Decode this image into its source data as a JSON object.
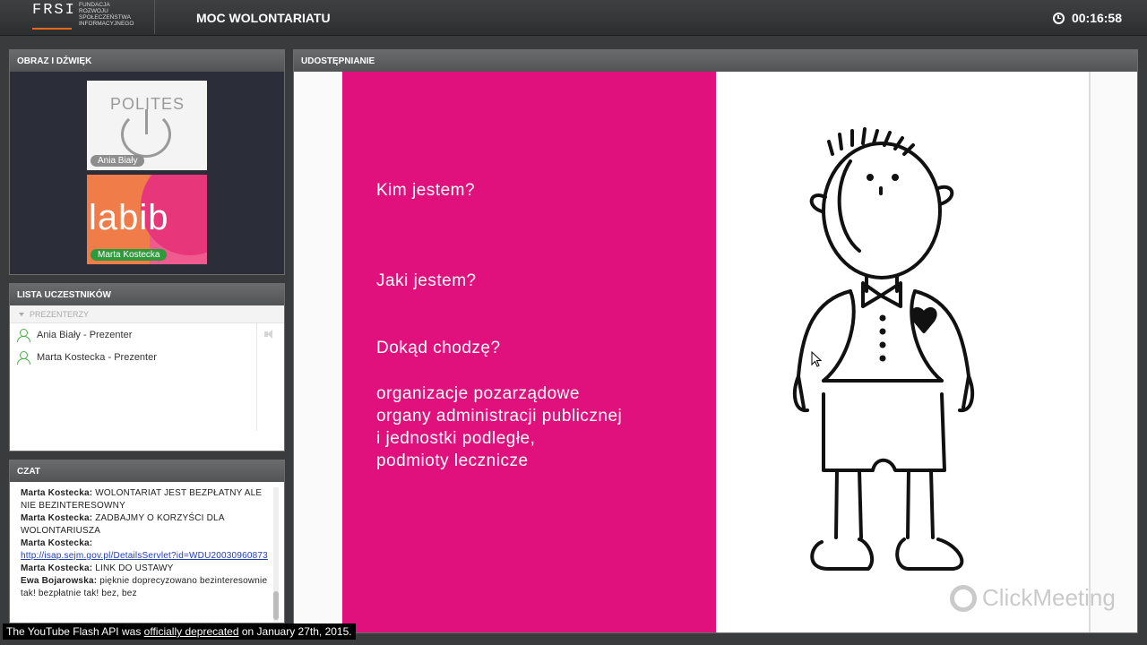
{
  "topbar": {
    "logo_main": "FRSI",
    "logo_sub": "FUNDACJA\nROZWOJU\nSPOŁECZEŃSTWA\nINFORMACYJNEGO",
    "title": "MOC WOLONTARIATU",
    "timer": "00:16:58"
  },
  "av_panel": {
    "title": "OBRAZ I DŹWIĘK",
    "thumbs": [
      {
        "logo": "POLITES",
        "name": "Ania Biały"
      },
      {
        "logo": "labib",
        "name": "Marta Kostecka"
      }
    ]
  },
  "participants": {
    "title": "LISTA UCZESTNIKÓW",
    "group": "PREZENTERZY",
    "items": [
      {
        "label": "Ania Biały - Prezenter"
      },
      {
        "label": "Marta Kostecka - Prezenter"
      }
    ]
  },
  "chat": {
    "title": "CZAT",
    "messages": [
      {
        "author": "Marta Kostecka:",
        "text": "WOLONTARIAT JEST BEZPŁATNY ALE NIE BEZINTERESOWNY"
      },
      {
        "author": "Marta Kostecka:",
        "text": "ZADBAJMY O KORZYŚCI DLA WOLONTARIUSZA"
      },
      {
        "author": "Marta Kostecka:",
        "text": "",
        "link": "http://isap.sejm.gov.pl/DetailsServlet?id=WDU20030960873"
      },
      {
        "author": "Marta Kostecka:",
        "text": "LINK DO USTAWY"
      },
      {
        "author": "Ewa Bojarowska:",
        "text": "pięknie doprecyzowano bezinteresownie tak! bezpłatnie tak! bez, bez"
      }
    ]
  },
  "share": {
    "title": "UDOSTĘPNIANIE",
    "slide": {
      "q1": "Kim jestem?",
      "q2": "Jaki jestem?",
      "q3": "Dokąd chodzę?",
      "list": [
        "organizacje pozarządowe",
        "organy administracji publicznej",
        "i jednostki podległe,",
        "podmioty lecznicze"
      ]
    },
    "watermark": "ClickMeeting"
  },
  "youtube_notice": {
    "before": "The YouTube Flash API was ",
    "link": "officially deprecated",
    "after": " on January 27th, 2015."
  }
}
